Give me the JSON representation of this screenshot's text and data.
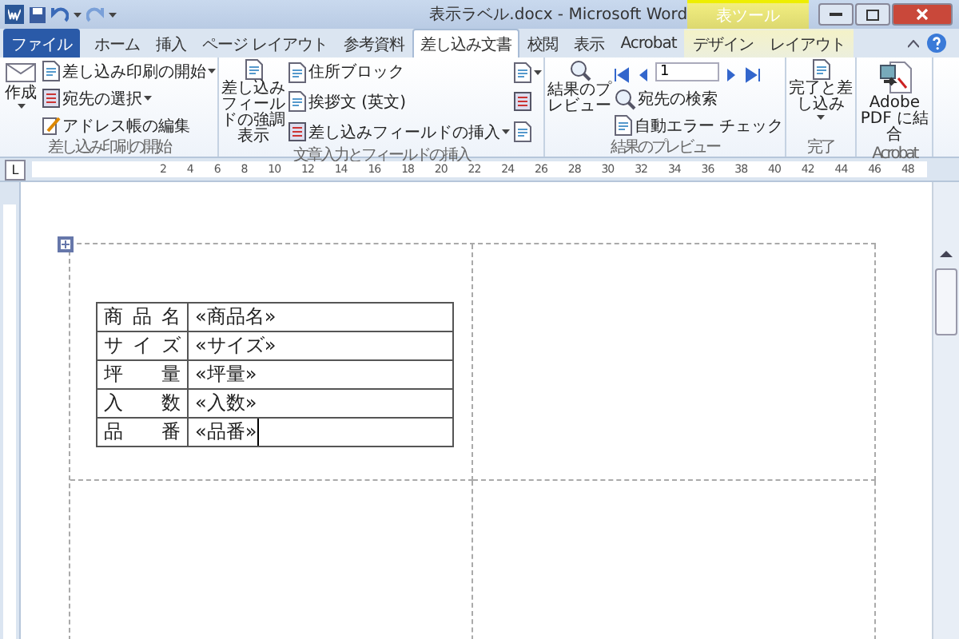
{
  "window": {
    "title": "表示ラベル.docx - Microsoft Word",
    "context_tab_group": "表ツール"
  },
  "tabs": [
    {
      "label": "ファイル",
      "kind": "file",
      "selected": false
    },
    {
      "label": "ホーム",
      "kind": "normal",
      "selected": false
    },
    {
      "label": "挿入",
      "kind": "normal",
      "selected": false
    },
    {
      "label": "ページ レイアウト",
      "kind": "normal",
      "selected": false
    },
    {
      "label": "参考資料",
      "kind": "normal",
      "selected": false
    },
    {
      "label": "差し込み文書",
      "kind": "normal",
      "selected": true
    },
    {
      "label": "校閲",
      "kind": "normal",
      "selected": false
    },
    {
      "label": "表示",
      "kind": "normal",
      "selected": false
    },
    {
      "label": "Acrobat",
      "kind": "normal",
      "selected": false
    },
    {
      "label": "デザイン",
      "kind": "context",
      "selected": false
    },
    {
      "label": "レイアウト",
      "kind": "context",
      "selected": false
    }
  ],
  "ribbon": {
    "groups": [
      {
        "label": "差し込み印刷の開始",
        "items": [
          {
            "kind": "large",
            "label": "作成",
            "dropdown": true
          },
          {
            "kind": "column",
            "items": [
              {
                "label": "差し込み印刷の開始",
                "dropdown": true
              },
              {
                "label": "宛先の選択",
                "dropdown": true
              },
              {
                "label": "アドレス帳の編集",
                "dropdown": false
              }
            ]
          }
        ]
      },
      {
        "label": "文章入力とフィールドの挿入",
        "items": [
          {
            "kind": "large",
            "label": "差し込みフィールドの強調表示",
            "dropdown": false
          },
          {
            "kind": "column",
            "items": [
              {
                "label": "住所ブロック",
                "dropdown": false
              },
              {
                "label": "挨拶文 (英文)",
                "dropdown": false
              },
              {
                "label": "差し込みフィールドの挿入",
                "dropdown": true
              }
            ]
          },
          {
            "kind": "icons",
            "items": [
              {
                "dropdown": true
              },
              {
                "dropdown": false
              },
              {
                "dropdown": false
              }
            ]
          }
        ]
      },
      {
        "label": "結果のプレビュー",
        "items": [
          {
            "kind": "large",
            "label": "結果のプレビュー",
            "dropdown": false
          },
          {
            "kind": "nav",
            "record": "1",
            "items": [
              {
                "label": "宛先の検索",
                "dropdown": false
              },
              {
                "label": "自動エラー チェック",
                "dropdown": false
              }
            ]
          }
        ]
      },
      {
        "label": "完了",
        "items": [
          {
            "kind": "large",
            "label": "完了と差し込み",
            "dropdown": true
          }
        ]
      },
      {
        "label": "Acrobat",
        "items": [
          {
            "kind": "large",
            "label": "Adobe PDF に結合",
            "dropdown": false
          }
        ]
      }
    ]
  },
  "ruler": {
    "tab_marker": "L",
    "labels": [
      "2",
      "4",
      "6",
      "8",
      "10",
      "12",
      "14",
      "16",
      "18",
      "20",
      "22",
      "24",
      "26",
      "28",
      "30",
      "32",
      "34",
      "36",
      "38",
      "40",
      "42",
      "44",
      "46",
      "48"
    ]
  },
  "table": {
    "rows": [
      {
        "label": "商品名",
        "field": "«商品名»",
        "cursor": false
      },
      {
        "label": "サイズ",
        "field": "«サイズ»",
        "cursor": false
      },
      {
        "label": "坪量",
        "field": "«坪量»",
        "cursor": false
      },
      {
        "label": "入数",
        "field": "«入数»",
        "cursor": false
      },
      {
        "label": "品番",
        "field": "«品番»",
        "cursor": true
      }
    ]
  }
}
